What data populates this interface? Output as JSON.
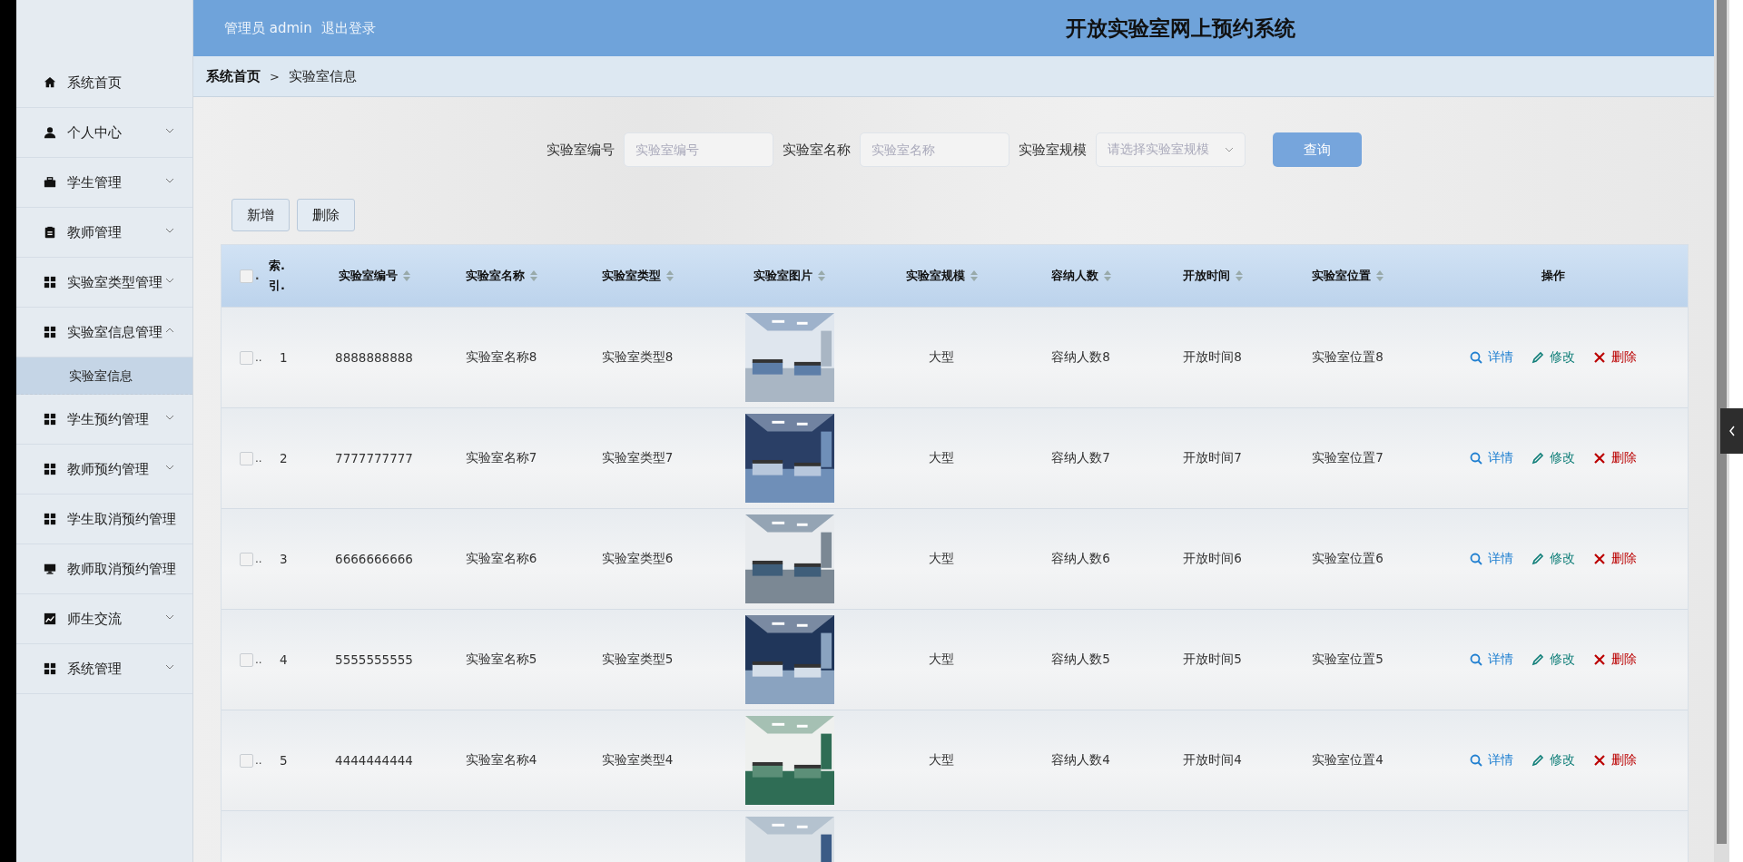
{
  "header": {
    "user_label": "管理员 admin",
    "logout": "退出登录",
    "title": "开放实验室网上预约系统"
  },
  "sidebar": {
    "items": [
      {
        "label": "系统首页",
        "selected": false
      },
      {
        "label": "个人中心",
        "selected": false,
        "expanded": false
      },
      {
        "label": "学生管理",
        "selected": false,
        "expanded": false
      },
      {
        "label": "教师管理",
        "selected": false,
        "expanded": false
      },
      {
        "label": "实验室类型管理",
        "selected": false,
        "expanded": false
      },
      {
        "label": "实验室信息管理",
        "selected": false,
        "expanded": true,
        "children": [
          {
            "label": "实验室信息",
            "selected": true
          }
        ]
      },
      {
        "label": "学生预约管理",
        "selected": false,
        "expanded": false
      },
      {
        "label": "教师预约管理",
        "selected": false,
        "expanded": false
      },
      {
        "label": "学生取消预约管理",
        "selected": false
      },
      {
        "label": "教师取消预约管理",
        "selected": false
      },
      {
        "label": "师生交流",
        "selected": false,
        "expanded": false
      },
      {
        "label": "系统管理",
        "selected": false,
        "expanded": false
      }
    ]
  },
  "breadcrumb": {
    "home": "系统首页",
    "separator": ">",
    "current": "实验室信息"
  },
  "search": {
    "fields": [
      {
        "kind": "input",
        "label": "实验室编号",
        "placeholder": "实验室编号"
      },
      {
        "kind": "input",
        "label": "实验室名称",
        "placeholder": "实验室名称"
      },
      {
        "kind": "select",
        "label": "实验室规模",
        "placeholder": "请选择实验室规模"
      }
    ],
    "button": "查询"
  },
  "actions": [
    "新增",
    "删除"
  ],
  "table": {
    "select_all": {
      "checked": false,
      "mark": "."
    },
    "columns": [
      {
        "label": "索.引.",
        "sortable": false
      },
      {
        "label": "实验室编号",
        "sortable": true
      },
      {
        "label": "实验室名称",
        "sortable": true
      },
      {
        "label": "实验室类型",
        "sortable": true
      },
      {
        "label": "实验室图片",
        "sortable": true
      },
      {
        "label": "实验室规模",
        "sortable": true
      },
      {
        "label": "容纳人数",
        "sortable": true
      },
      {
        "label": "开放时间",
        "sortable": true
      },
      {
        "label": "实验室位置",
        "sortable": true
      },
      {
        "label": "操作",
        "sortable": false
      }
    ],
    "rows": [
      {
        "checked": false,
        "mark": "..",
        "cells": [
          "1",
          "8888888888",
          "实验室名称8",
          "实验室类型8",
          {
            "kind": "picture"
          },
          "大型",
          "容纳人数8",
          "开放时间8",
          "实验室位置8"
        ],
        "actions": [
          {
            "kind": "detail",
            "label": "详情"
          },
          {
            "kind": "edit",
            "label": "修改"
          },
          {
            "kind": "delete",
            "label": "删除"
          }
        ]
      },
      {
        "checked": false,
        "mark": "..",
        "cells": [
          "2",
          "7777777777",
          "实验室名称7",
          "实验室类型7",
          {
            "kind": "picture"
          },
          "大型",
          "容纳人数7",
          "开放时间7",
          "实验室位置7"
        ],
        "actions": [
          {
            "kind": "detail",
            "label": "详情"
          },
          {
            "kind": "edit",
            "label": "修改"
          },
          {
            "kind": "delete",
            "label": "删除"
          }
        ]
      },
      {
        "checked": false,
        "mark": "..",
        "cells": [
          "3",
          "6666666666",
          "实验室名称6",
          "实验室类型6",
          {
            "kind": "picture"
          },
          "大型",
          "容纳人数6",
          "开放时间6",
          "实验室位置6"
        ],
        "actions": [
          {
            "kind": "detail",
            "label": "详情"
          },
          {
            "kind": "edit",
            "label": "修改"
          },
          {
            "kind": "delete",
            "label": "删除"
          }
        ]
      },
      {
        "checked": false,
        "mark": "..",
        "cells": [
          "4",
          "5555555555",
          "实验室名称5",
          "实验室类型5",
          {
            "kind": "picture"
          },
          "大型",
          "容纳人数5",
          "开放时间5",
          "实验室位置5"
        ],
        "actions": [
          {
            "kind": "detail",
            "label": "详情"
          },
          {
            "kind": "edit",
            "label": "修改"
          },
          {
            "kind": "delete",
            "label": "删除"
          }
        ]
      },
      {
        "checked": false,
        "mark": "..",
        "cells": [
          "5",
          "4444444444",
          "实验室名称4",
          "实验室类型4",
          {
            "kind": "picture"
          },
          "大型",
          "容纳人数4",
          "开放时间4",
          "实验室位置4"
        ],
        "actions": [
          {
            "kind": "detail",
            "label": "详情"
          },
          {
            "kind": "edit",
            "label": "修改"
          },
          {
            "kind": "delete",
            "label": "删除"
          }
        ]
      }
    ],
    "partial_row": {
      "kind": "picture"
    }
  }
}
